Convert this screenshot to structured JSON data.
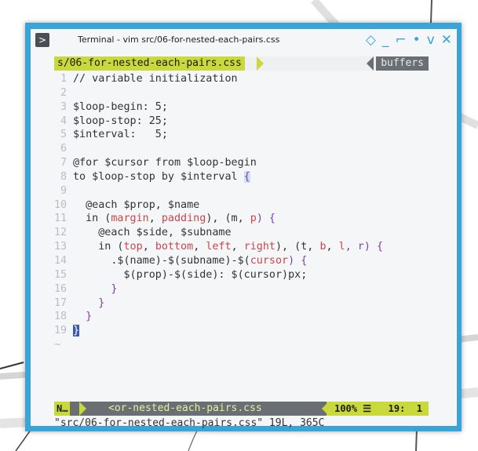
{
  "window": {
    "title": "Terminal - vim src/06-for-nested-each-pairs.css",
    "app_icon": ">",
    "controls": {
      "sticky": "◇",
      "minimize": "_",
      "maximize": "⌐",
      "dot": "•",
      "shade": "v",
      "close": "✕"
    }
  },
  "tabline": {
    "active": "s/06-for-nested-each-pairs.css",
    "right": "buffers"
  },
  "editor": {
    "line_numbers": [
      "1",
      "2",
      "3",
      "4",
      "5",
      "6",
      "7",
      "8",
      "9",
      "10",
      "11",
      "12",
      "13",
      "14",
      "15",
      "16",
      "17",
      "18",
      "19"
    ],
    "l1": "// variable initialization",
    "l3": "$loop-begin: 5;",
    "l4": "$loop-stop: 25;",
    "l5": "$interval:   5;",
    "l7": "@for $cursor from $loop-begin",
    "l8": "to $loop-stop by $interval ",
    "l8_brace": "{",
    "l10": "  @each $prop, $name",
    "l11": {
      "a": "  in (",
      "b": "margin",
      "c": ", ",
      "d": "padding",
      "e": "), (m, ",
      "f": "p",
      "g": ") {"
    },
    "l12": "    @each $side, $subname",
    "l13": {
      "a": "    in (",
      "b": "top",
      "c": ", ",
      "d": "bottom",
      "e": ", ",
      "f": "left",
      "g": ", ",
      "h": "right",
      "i": "), (t, ",
      "j": "b",
      "k": ", ",
      "l": "l",
      "m": ", r) {"
    },
    "l14": {
      "a": "      .$(name)-$(subname)-$(",
      "b": "cursor",
      "c": ") {"
    },
    "l15": "        $(prop)-$(side): $(cursor)px;",
    "l16": "      }",
    "l17": "    }",
    "l18": "  }",
    "l19": "}",
    "tilde": "~"
  },
  "statusline": {
    "mode": "N…",
    "file": "<or-nested-each-pairs.css",
    "right": "100% ☰   19:  1"
  },
  "cmdline": "\"src/06-for-nested-each-pairs.css\" 19L, 365C",
  "colors": {
    "frame": "#3aa4d8",
    "accent": "#c9d83a",
    "keyword": "#4a78b8",
    "string_red": "#c9474a",
    "brace": "#7a3fb0"
  }
}
